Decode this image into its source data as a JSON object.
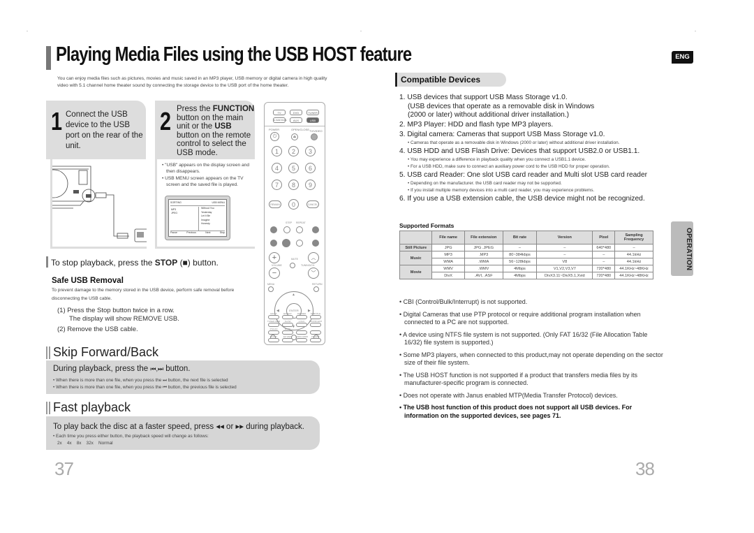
{
  "left_page": {
    "title": "Playing Media Files using the USB HOST feature",
    "intro": "You can enjoy media files such as pictures, movies and music saved in an MP3 player, USB memory or digital camera in high quality video with 5.1 channel home theater sound by connecting the storage device to the USB port of the home theater.",
    "step1": {
      "number": "1",
      "text": "Connect the USB device to the USB port on the rear of the unit."
    },
    "step2": {
      "number": "2",
      "text_parts": [
        "Press the ",
        "FUNCTION",
        " button on the main unit or the ",
        "USB",
        " button on the remote control to select the USB mode."
      ],
      "bullets": [
        "• \"USB\" appears on the display screen and then disappears.",
        "• USB MENU screen appears on the TV screen and the saved file is played."
      ],
      "tv_screen": {
        "header": "SORTING",
        "header_right": "USB MENU",
        "folders": [
          "MP3",
          "JPEG"
        ],
        "files": [
          "Without You",
          "Yesterday",
          "Let It Be",
          "Imagine",
          "Honesty"
        ],
        "footer": [
          "Pause",
          "Previous",
          "Next",
          "Stop"
        ]
      }
    },
    "remote": {
      "top_buttons": [
        "TV",
        "DVD",
        "TUNER",
        "D.IN/BYPASS",
        "AUX",
        "USB"
      ],
      "labels": [
        "POWER",
        "OPEN/CLOSE",
        "TV/VIDEO"
      ],
      "digits": [
        "1",
        "2",
        "3",
        "4",
        "5",
        "6",
        "7",
        "8",
        "9",
        "0"
      ],
      "side_digits": [
        "REMAIN",
        "CANCEL"
      ],
      "step_repeat": [
        "STEP",
        "REPEAT"
      ],
      "volume": "VOLUME",
      "mute": "MUTE",
      "tuning": "TUNING/CH",
      "menu": "MENU",
      "return": "RETURN",
      "enter": "ENTER",
      "bottom_rows": [
        [
          "MO/ST",
          "EFFECT",
          "DIMMER",
          "SUBTITLE"
        ],
        [
          "TUNER MEMORY",
          "SLOW",
          "LOGO",
          "SOUND EDIT"
        ],
        [
          "P.SCAN",
          "MUTE",
          "",
          ""
        ],
        [
          "ZOOM",
          "EZ VIEW",
          "AUDIO MODE",
          "DIGEST"
        ]
      ]
    },
    "stop_line": {
      "prefix": "To stop playback, press the ",
      "bold": "STOP",
      "symbol": "(■)",
      "suffix": " button."
    },
    "safe_removal": {
      "title": "Safe USB Removal",
      "desc": "To prevent damage to the memory stored in the USB device, perform safe removal before disconnecting the USB cable.",
      "steps": [
        "(1) Press the Stop button twice in a row.",
        "The display will show REMOVE      USB.",
        "(2)  Remove the USB cable."
      ]
    },
    "skip": {
      "title": "Skip Forward/Back",
      "head_prefix": "During playback, press the ",
      "head_icons": "⏮,⏭",
      "head_suffix": " button.",
      "bullets": [
        "• When there is more than one file, when you press the  ⏭  button, the next file is selected",
        "• When there is more than one file, when you press the  ⏮  button, the previous file is selected"
      ]
    },
    "fast": {
      "title": "Fast playback",
      "head": "To play back the disc at a faster speed, press ◂◂ or ▸▸  during playback.",
      "bullet": "• Each time you press either button, the playback speed will change as follows:",
      "speeds": "2x    4x    8x    32x    Normal"
    },
    "page_number": "37"
  },
  "right_page": {
    "lang_badge": "ENG",
    "section_tab": "OPERATION",
    "compat_title": "Compatible Devices",
    "compat_items": [
      {
        "main": "1. USB devices that support USB Mass Storage v1.0.",
        "cont": [
          "(USB devices that operate as a removable disk in Windows",
          "(2000 or later) without additional driver installation.)"
        ],
        "subs": []
      },
      {
        "main": "2. MP3 Player: HDD and flash type MP3 players.",
        "cont": [],
        "subs": []
      },
      {
        "main": "3. Digital camera: Cameras that support USB Mass Storage v1.0.",
        "cont": [],
        "subs": [
          "• Cameras that operate as a removable disk in Windows (2000 or later) without additional driver installation."
        ]
      },
      {
        "main": "4. USB HDD and USB Flash Drive: Devices that support USB2.0 or USB1.1.",
        "cont": [],
        "subs": [
          "• You may experience a difference in playback quality when you connect a USB1.1 device.",
          "• For a USB HDD, make sure to connect an auxiliary power cord to the USB HDD for proper operation."
        ]
      },
      {
        "main": "5. USB card Reader: One slot USB card reader and Multi slot USB card reader",
        "cont": [],
        "subs": [
          "• Depending on the manufacturer. the USB card reader may not be supported.",
          "• If you install multiple memory devices into a multi card reader, you may experience problems."
        ]
      },
      {
        "main": "6. If you use a USB extension cable, the USB device might not be recognized.",
        "cont": [],
        "subs": []
      }
    ],
    "formats": {
      "title": "Supported Formats",
      "headers": [
        "",
        "File name",
        "File extension",
        "Bit rate",
        "Version",
        "Pixel",
        "Sampling Frequency"
      ],
      "groups": [
        {
          "label": "Still Picture",
          "rows": [
            [
              "JPG",
              "JPG .JPEG",
              "–",
              "–",
              "640*480",
              "–"
            ]
          ]
        },
        {
          "label": "Music",
          "rows": [
            [
              "MP3",
              ".MP3",
              "80~384kbps",
              "–",
              "–",
              "44.1kHz"
            ],
            [
              "WMA",
              ".WMA",
              "56~128kbps",
              "V8",
              "–",
              "44.1kHz"
            ]
          ]
        },
        {
          "label": "Movie",
          "rows": [
            [
              "WMV",
              ".WMV",
              "4Mbps",
              "V1,V2,V3,V7",
              "720*480",
              "44.1KHz~48KHz"
            ],
            [
              "DivX",
              ".AVI, .ASF",
              "4Mbps",
              "DivX3.11~DivX5.1,Xvid",
              "720*480",
              "44.1KHz~48KHz"
            ]
          ]
        }
      ]
    },
    "notes": [
      {
        "text": "• CBI (Control/Bulk/Interrupt) is not supported.",
        "bold": false
      },
      {
        "text": "• Digital Cameras that use PTP protocol or require additional program installation when connected to a PC are not supported.",
        "bold": false
      },
      {
        "text": "• A device using NTFS file system is not supported. (Only FAT 16/32 (File Allocation Table 16/32) file system is supported.)",
        "bold": false
      },
      {
        "text": "• Some MP3 players, when connected to this product,may not operate depending on the sector size of their file system.",
        "bold": false
      },
      {
        "text": "• The USB HOST function is not supported if a product that transfers media files by its manufacturer-specific program is connected.",
        "bold": false
      },
      {
        "text": "• Does not operate with Janus enabled MTP(Media Transfer Protocol) devices.",
        "bold": false
      },
      {
        "text": "• The USB host function of this product does not support all USB devices. For information on the supported devices, see pages 71.",
        "bold": true
      }
    ],
    "page_number": "38"
  }
}
